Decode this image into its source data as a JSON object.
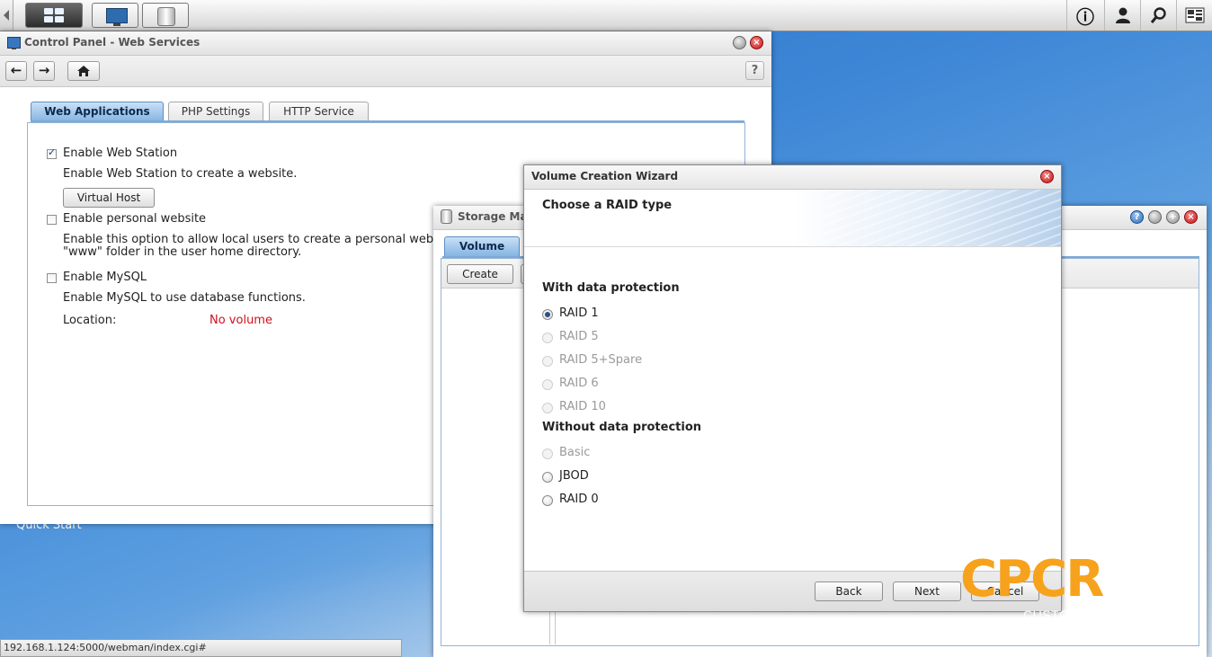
{
  "status_bar": {
    "url": "192.168.1.124:5000/webman/index.cgi#"
  },
  "desktop": {
    "quick_start": "Quick Start"
  },
  "taskbar": {
    "icons": [
      "main-menu-icon",
      "control-panel-icon",
      "storage-manager-icon",
      "info-icon",
      "user-icon",
      "search-icon",
      "widgets-icon"
    ],
    "info_glyph": "ⓘ",
    "search_glyph": "⚲"
  },
  "control_panel": {
    "title": "Control Panel - Web Services",
    "help": "?",
    "tabs": [
      "Web Applications",
      "PHP Settings",
      "HTTP Service"
    ],
    "web_station": {
      "label": "Enable Web Station",
      "checked": true,
      "desc": "Enable Web Station to create a website."
    },
    "virtual_host_button": "Virtual Host",
    "personal": {
      "label": "Enable personal website",
      "checked": false,
      "desc1": "Enable this option to allow local users to create a personal websi",
      "desc2": "\"www\" folder in the user home directory."
    },
    "mysql": {
      "label": "Enable MySQL",
      "checked": false,
      "desc": "Enable MySQL to use database functions."
    },
    "location_label": "Location:",
    "location_value": "No volume",
    "location_color": "#d0101a"
  },
  "storage_manager": {
    "title": "Storage Ma",
    "tab": "Volume",
    "create_button": "Create"
  },
  "wizard": {
    "title": "Volume Creation Wizard",
    "header": "Choose a RAID type",
    "section_protected": "With data protection",
    "protected_options": [
      {
        "label": "RAID 1",
        "selected": true,
        "disabled": false
      },
      {
        "label": "RAID 5",
        "selected": false,
        "disabled": true
      },
      {
        "label": "RAID 5+Spare",
        "selected": false,
        "disabled": true
      },
      {
        "label": "RAID 6",
        "selected": false,
        "disabled": true
      },
      {
        "label": "RAID 10",
        "selected": false,
        "disabled": true
      }
    ],
    "section_unprotected": "Without data protection",
    "unprotected_options": [
      {
        "label": "Basic",
        "selected": false,
        "disabled": true
      },
      {
        "label": "JBOD",
        "selected": false,
        "disabled": false
      },
      {
        "label": "RAID 0",
        "selected": false,
        "disabled": false
      }
    ],
    "buttons": {
      "back": "Back",
      "next": "Next",
      "cancel": "Cancel"
    }
  },
  "watermark": {
    "big": "CPCR",
    "small": "CUSTOM PC REVIEW",
    "color": "#f7a21c"
  }
}
